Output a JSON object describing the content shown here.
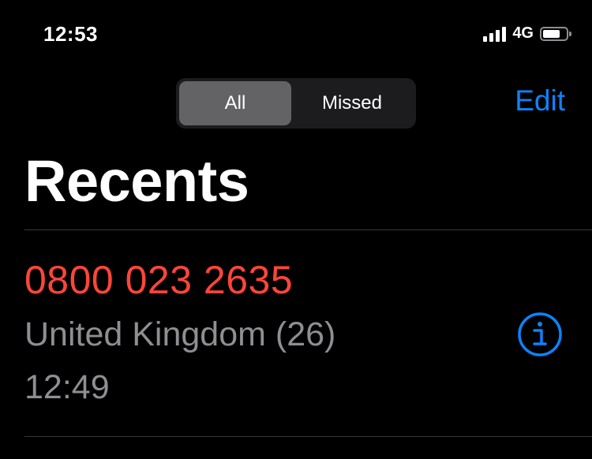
{
  "status_bar": {
    "time": "12:53",
    "network": "4G",
    "battery_level": 0.75
  },
  "filter": {
    "options": [
      {
        "label": "All",
        "selected": true
      },
      {
        "label": "Missed",
        "selected": false
      }
    ]
  },
  "header": {
    "edit_label": "Edit",
    "title": "Recents"
  },
  "calls": [
    {
      "number": "0800 023 2635",
      "label": "United Kingdom (26)",
      "time": "12:49",
      "missed": true
    }
  ],
  "colors": {
    "accent": "#0a84ff",
    "missed": "#ff453a",
    "secondary_text": "#8e8e93",
    "background": "#000000"
  }
}
